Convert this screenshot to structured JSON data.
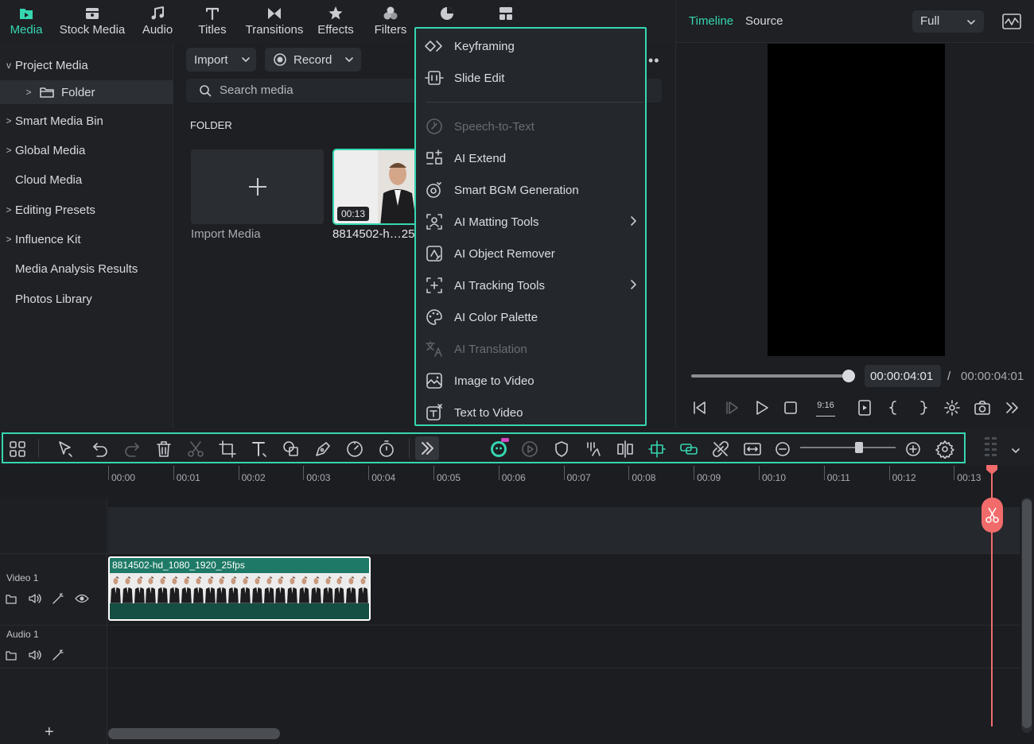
{
  "tabs": [
    {
      "label": "Media",
      "icon": "media-folder-icon",
      "active": true
    },
    {
      "label": "Stock Media",
      "icon": "stock-media-icon"
    },
    {
      "label": "Audio",
      "icon": "music-note-icon"
    },
    {
      "label": "Titles",
      "icon": "titles-t-icon"
    },
    {
      "label": "Transitions",
      "icon": "transitions-icon"
    },
    {
      "label": "Effects",
      "icon": "effects-star-icon"
    },
    {
      "label": "Filters",
      "icon": "filters-icon"
    },
    {
      "label": "",
      "icon": "stickers-pie-icon"
    },
    {
      "label": "",
      "icon": "templates-grid-icon"
    }
  ],
  "sidebar": {
    "items": [
      {
        "label": "Project Media",
        "expand": "v"
      },
      {
        "label": "Folder",
        "expand": ">"
      },
      {
        "label": "Smart Media Bin",
        "expand": ">"
      },
      {
        "label": "Global Media",
        "expand": ">"
      },
      {
        "label": "Cloud Media",
        "expand": ""
      },
      {
        "label": "Editing Presets",
        "expand": ">"
      },
      {
        "label": "Influence Kit",
        "expand": ">"
      },
      {
        "label": "Media Analysis Results",
        "expand": ""
      },
      {
        "label": "Photos Library",
        "expand": ""
      }
    ]
  },
  "media": {
    "import_label": "Import",
    "record_label": "Record",
    "search_placeholder": "Search media",
    "folder_heading": "FOLDER",
    "import_media_label": "Import Media",
    "clip_duration": "00:13",
    "clip_name": "8814502-h…25"
  },
  "menu": {
    "items": [
      {
        "label": "Keyframing",
        "icon": "keyframe-icon",
        "disabled": false
      },
      {
        "label": "Slide Edit",
        "icon": "slide-edit-icon",
        "disabled": false
      },
      {
        "label": "Speech-to-Text",
        "icon": "speech-to-text-icon",
        "disabled": true
      },
      {
        "label": "AI Extend",
        "icon": "ai-extend-icon",
        "disabled": false
      },
      {
        "label": "Smart BGM Generation",
        "icon": "bgm-generation-icon",
        "disabled": false
      },
      {
        "label": "AI Matting Tools",
        "icon": "ai-matting-icon",
        "disabled": false,
        "submenu": true
      },
      {
        "label": "AI Object Remover",
        "icon": "object-remover-icon",
        "disabled": false
      },
      {
        "label": "AI Tracking Tools",
        "icon": "ai-tracking-icon",
        "disabled": false,
        "submenu": true
      },
      {
        "label": "AI Color Palette",
        "icon": "color-palette-icon",
        "disabled": false
      },
      {
        "label": "AI Translation",
        "icon": "translation-icon",
        "disabled": true
      },
      {
        "label": "Image to Video",
        "icon": "image-to-video-icon",
        "disabled": false
      },
      {
        "label": "Text to Video",
        "icon": "text-to-video-icon",
        "disabled": false
      }
    ]
  },
  "preview": {
    "tab_timeline": "Timeline",
    "tab_source": "Source",
    "quality": "Full",
    "current_time": "00:00:04:01",
    "separator": "/",
    "total_time": "00:00:04:01",
    "aspect": "9:16"
  },
  "toolbar": {
    "icons": [
      "grid-layout-icon",
      "select-arrow-icon",
      "undo-icon",
      "redo-icon",
      "delete-icon",
      "split-scissors-icon",
      "crop-icon",
      "text-icon",
      "shape-icon",
      "pen-icon",
      "speed-icon",
      "timer-icon",
      "more-chevrons-icon",
      "ai-mascot-icon",
      "auto-reframe-icon",
      "shield-icon",
      "audio-beat-icon",
      "mirror-icon",
      "snap-icon",
      "link-clip-icon",
      "unlink-icon",
      "fit-width-icon",
      "zoom-out-icon",
      "zoom-in-icon",
      "settings-icon"
    ],
    "zoom_level": 0.62
  },
  "timeline": {
    "ticks": [
      "00:00",
      "00:01",
      "00:02",
      "00:03",
      "00:04",
      "00:05",
      "00:06",
      "00:07",
      "00:08",
      "00:09",
      "00:10",
      "00:11",
      "00:12",
      "00:13"
    ],
    "video_track": "Video 1",
    "audio_track": "Audio 1",
    "clip_title": "8814502-hd_1080_1920_25fps",
    "add_track": "+"
  },
  "colors": {
    "accent": "#36d6b0",
    "playhead": "#f26b6b",
    "clip": "#1e7a66"
  }
}
